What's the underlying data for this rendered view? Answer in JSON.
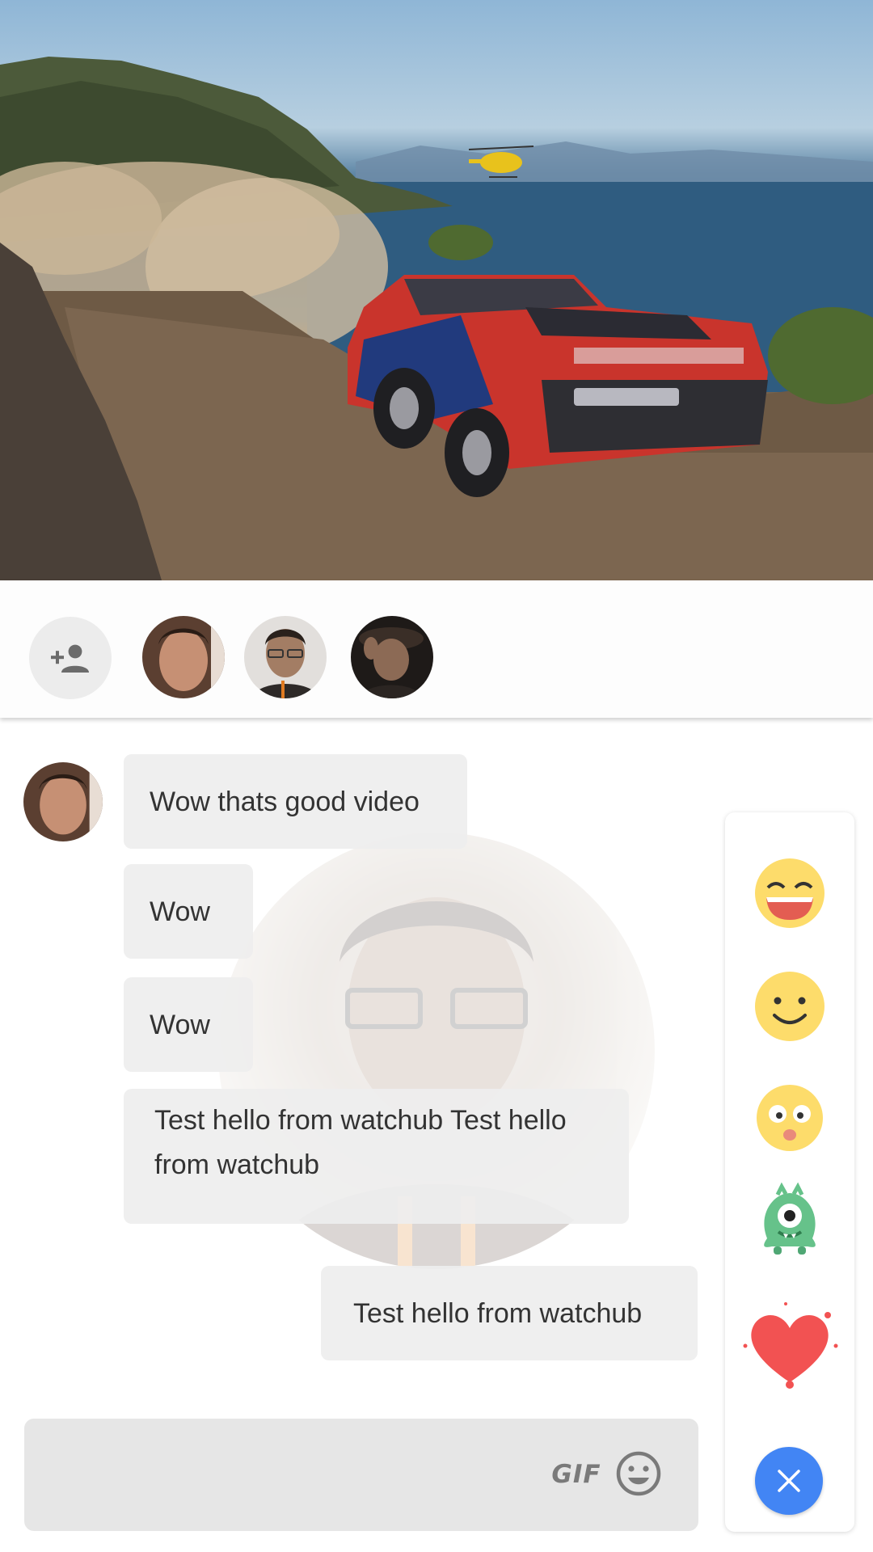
{
  "participants": {
    "add_icon": "person-add-icon",
    "avatars": [
      "avatar-1",
      "avatar-2",
      "avatar-3"
    ]
  },
  "messages": [
    {
      "text": "Wow thats good video"
    },
    {
      "text": "Wow"
    },
    {
      "text": "Wow"
    },
    {
      "text": "Test hello from watchub Test hello from watchub"
    },
    {
      "text": "Test hello from watchub",
      "own": true
    }
  ],
  "composer": {
    "value": "",
    "placeholder": "",
    "gif_label": "GIF",
    "emoji_icon": "smiley-icon"
  },
  "reactions": [
    "grin-emoji",
    "smile-emoji",
    "surprised-emoji",
    "monster-sticker",
    "heart-sticker"
  ],
  "colors": {
    "accent": "#4285f4",
    "bubble": "#eeeeee",
    "emoji_yellow": "#fddc6b",
    "heart": "#f25252",
    "monster": "#66c28a"
  }
}
